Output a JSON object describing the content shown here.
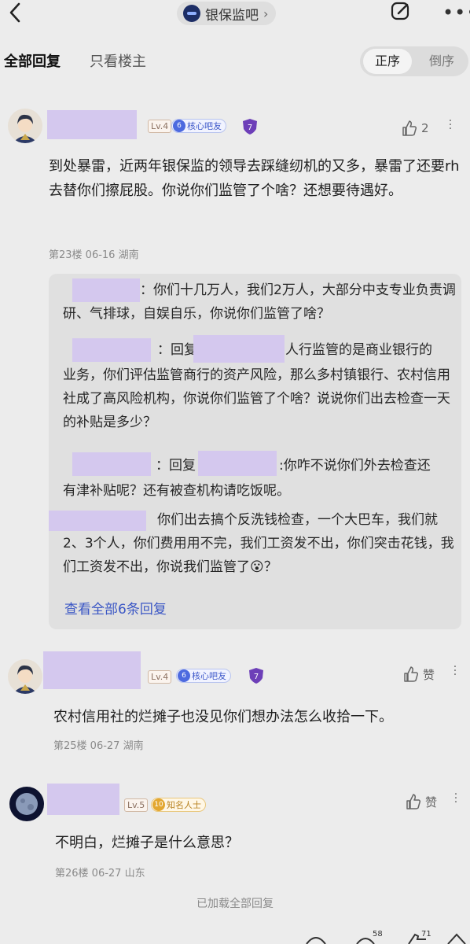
{
  "header": {
    "forum_name": "银保监吧",
    "chevron": "›"
  },
  "tabs": {
    "all_replies": "全部回复",
    "owner_only": "只看楼主",
    "sort_asc": "正序",
    "sort_desc": "倒序"
  },
  "posts": [
    {
      "level": "Lv.4",
      "badge_num": "6",
      "badge": "核心吧友",
      "shield_num": "7",
      "likes": "2",
      "body": "到处暴雷，近两年银保监的领导去踩缝纫机的又多，暴雷了还要rh去替你们擦屁股。你说你们监管了个啥？还想要待遇好。",
      "meta": "第23楼   06-16   湖南",
      "replies": [
        "：你们十几万人，我们2万人，大部分中支专业负责调研、气排球，自娱自乐，你说你们监管了啥？",
        "：回复",
        "人行监管的是商业银行的",
        "业务，你们评估监管商行的资产风险，那么多村镇银行、农村信用社成了高风险机构，你说你们监管了个啥？说说你们出去检查一天的补贴是多少？",
        "：回复",
        ":你咋不说你们外去检查还",
        "有津补贴呢？还有被查机构请吃饭呢。",
        "你们出去搞个反洗钱检查，一个大巴车，我们就2、3个人，你们费用用不完，我们工资发不出，你们突击花钱，我们工资发不出，你说我们监管了😮？"
      ],
      "view_all": "查看全部6条回复"
    },
    {
      "level": "Lv.4",
      "badge_num": "6",
      "badge": "核心吧友",
      "shield_num": "7",
      "likes": "赞",
      "body": "农村信用社的烂摊子也没见你们想办法怎么收拾一下。",
      "meta": "第25楼   06-27   湖南"
    },
    {
      "level": "Lv.5",
      "badge_num": "10",
      "badge": "知名人士",
      "likes": "赞",
      "body": "不明白，烂摊子是什么意思？",
      "meta": "第26楼   06-27   山东"
    }
  ],
  "footer": {
    "loaded_all": "已加载全部回复",
    "comment_count": "58",
    "like_count": "71"
  },
  "colors": {
    "accent_blue": "#3b57c5",
    "redaction": "#d4c8ee",
    "background": "#ececec"
  },
  "icons": [
    "back-icon",
    "forum-logo-icon",
    "edit-icon",
    "more-icon",
    "thumb-up-icon",
    "more-vertical-icon",
    "share-icon",
    "comment-icon"
  ]
}
